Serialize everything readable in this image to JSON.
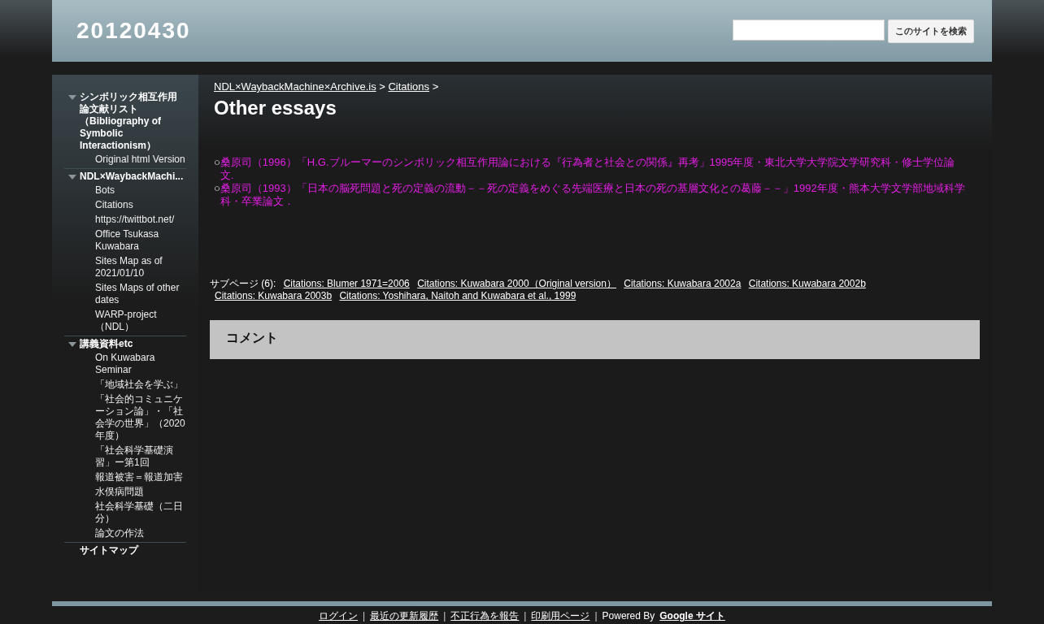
{
  "header": {
    "site_title": "20120430",
    "search": {
      "button": "このサイトを検索"
    }
  },
  "sidebar": {
    "sections": [
      {
        "label": "シンボリック相互作用論文献リスト（Bibliography of Symbolic Interactionism）",
        "kind": "group",
        "expanded": true,
        "children": [
          "Original html Version"
        ]
      },
      {
        "label": "NDL×WaybackMachi...",
        "kind": "group",
        "expanded": true,
        "children": [
          "Bots",
          "Citations",
          "https://twittbot.net/",
          "Office Tsukasa Kuwabara",
          "Sites Map as of 2021/01/10",
          "Sites Maps of other dates",
          "WARP-project（NDL）"
        ]
      },
      {
        "label": "講義資料etc",
        "kind": "group",
        "expanded": true,
        "children": [
          "On Kuwabara Seminar",
          "「地域社会を学ぶ」",
          "「社会的コミュニケーション論」・「社会学の世界」（2020年度）",
          "「社会科学基礎演習」ー第1回",
          "報道被害＝報道加害",
          "水俣病問題",
          "社会科学基礎（二日分）",
          "論文の作法"
        ]
      },
      {
        "label": "サイトマップ",
        "kind": "link"
      }
    ]
  },
  "breadcrumb": [
    {
      "label": "NDL×WaybackMachine×Archive.is",
      "separator": ">"
    },
    {
      "label": "Citations",
      "separator": ">"
    }
  ],
  "page_title": "Other essays",
  "essays": [
    {
      "bullet": "○",
      "text": "桑原司（1996）「H.G.ブルーマーのシンボリック相互作用論における『行為者と社会との関係』再考」1995年度・東北大学大学院文学研究科・修士学位論文."
    },
    {
      "bullet": "○",
      "text": "桑原司（1993）「日本の脳死問題と死の定義の流動－－死の定義をめぐる先端医療と日本の死の基層文化との葛藤－－」1992年度・熊本大学文学部地域科学科・卒業論文．"
    }
  ],
  "subpages": {
    "label": "サブページ (6):",
    "links": [
      "Citations: Blumer 1971=2006",
      "Citations: Kuwabara 2000（Original version）",
      "Citations: Kuwabara 2002a",
      "Citations: Kuwabara 2002b",
      "Citations: Kuwabara 2003b",
      "Citations: Yoshihara, Naitoh and Kuwabara et al., 1999"
    ]
  },
  "comments": {
    "title": "コメント"
  },
  "footer": {
    "items": [
      {
        "kind": "link",
        "text": "ログイン"
      },
      {
        "kind": "separator",
        "text": "|"
      },
      {
        "kind": "link",
        "text": "最近の更新履歴"
      },
      {
        "kind": "separator",
        "text": "|"
      },
      {
        "kind": "link",
        "text": "不正行為を報告"
      },
      {
        "kind": "separator",
        "text": "|"
      },
      {
        "kind": "link",
        "text": "印刷用ページ"
      },
      {
        "kind": "separator",
        "text": "|"
      },
      {
        "kind": "text",
        "text": "Powered By"
      },
      {
        "kind": "brand",
        "text": "Google サイト"
      }
    ]
  }
}
